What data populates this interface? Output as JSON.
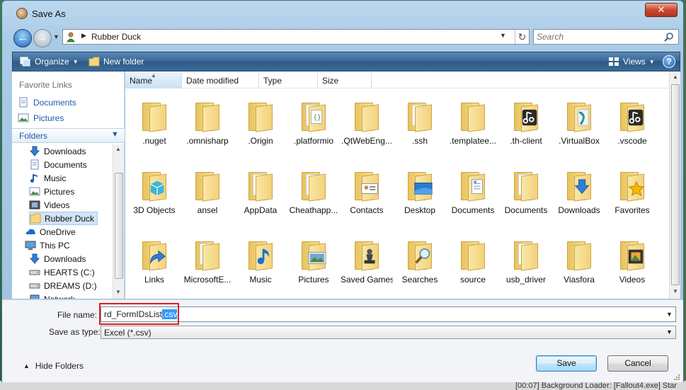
{
  "window": {
    "title": "Save As",
    "close_label": "✕"
  },
  "address": {
    "path": "Rubber Duck",
    "separator": "▶"
  },
  "search": {
    "placeholder": "Search"
  },
  "toolbar": {
    "organize": "Organize",
    "new_folder": "New folder",
    "views": "Views",
    "help": "?"
  },
  "left_pane": {
    "favorites_header": "Favorite Links",
    "favorites": [
      {
        "label": "Documents",
        "icon": "documents-icon"
      },
      {
        "label": "Pictures",
        "icon": "pictures-icon"
      }
    ],
    "folders_header": "Folders",
    "tree": [
      {
        "label": "Downloads",
        "icon": "download-arrow-icon",
        "indent": 1
      },
      {
        "label": "Documents",
        "icon": "documents-icon",
        "indent": 1
      },
      {
        "label": "Music",
        "icon": "music-note-icon",
        "indent": 1
      },
      {
        "label": "Pictures",
        "icon": "pictures-icon",
        "indent": 1
      },
      {
        "label": "Videos",
        "icon": "videos-icon",
        "indent": 1
      },
      {
        "label": "Rubber Duck",
        "icon": "folder-icon",
        "indent": 1,
        "selected": true
      },
      {
        "label": "OneDrive",
        "icon": "onedrive-cloud-icon",
        "indent": 0
      },
      {
        "label": "This PC",
        "icon": "computer-icon",
        "indent": 0
      },
      {
        "label": "Downloads",
        "icon": "download-arrow-icon",
        "indent": 1
      },
      {
        "label": "HEARTS (C:)",
        "icon": "drive-icon",
        "indent": 1
      },
      {
        "label": "DREAMS (D:)",
        "icon": "drive-icon",
        "indent": 1
      },
      {
        "label": "Network",
        "icon": "network-icon",
        "indent": 1
      }
    ]
  },
  "columns": [
    "Name",
    "Date modified",
    "Type",
    "Size"
  ],
  "files": [
    {
      "label": ".nuget",
      "icon": "folder-icon"
    },
    {
      "label": ".omnisharp",
      "icon": "folder-icon"
    },
    {
      "label": ".Origin",
      "icon": "folder-icon"
    },
    {
      "label": ".platformio",
      "icon": "folder-code-icon"
    },
    {
      "label": ".QtWebEng...",
      "icon": "folder-icon"
    },
    {
      "label": ".ssh",
      "icon": "folder-pages-icon"
    },
    {
      "label": ".templatee...",
      "icon": "folder-icon"
    },
    {
      "label": ".th-client",
      "icon": "folder-music-app-icon"
    },
    {
      "label": ".VirtualBox",
      "icon": "folder-virtualbox-icon"
    },
    {
      "label": ".vscode",
      "icon": "folder-music-app-icon"
    },
    {
      "label": "3D Objects",
      "icon": "folder-3d-cube-icon"
    },
    {
      "label": "ansel",
      "icon": "folder-icon"
    },
    {
      "label": "AppData",
      "icon": "folder-pages-icon"
    },
    {
      "label": "Cheathapp...",
      "icon": "folder-pages-icon"
    },
    {
      "label": "Contacts",
      "icon": "folder-contacts-icon"
    },
    {
      "label": "Desktop",
      "icon": "folder-desktop-icon"
    },
    {
      "label": "Documents",
      "icon": "folder-documents-icon"
    },
    {
      "label": "Documents",
      "icon": "folder-pages-icon"
    },
    {
      "label": "Downloads",
      "icon": "folder-download-icon"
    },
    {
      "label": "Favorites",
      "icon": "folder-star-icon"
    },
    {
      "label": "Links",
      "icon": "folder-link-arrow-icon"
    },
    {
      "label": "MicrosoftE...",
      "icon": "folder-pages-icon"
    },
    {
      "label": "Music",
      "icon": "folder-music-note-icon"
    },
    {
      "label": "Pictures",
      "icon": "folder-pictures-icon"
    },
    {
      "label": "Saved Games",
      "icon": "folder-chess-icon"
    },
    {
      "label": "Searches",
      "icon": "folder-magnifier-icon"
    },
    {
      "label": "source",
      "icon": "folder-icon"
    },
    {
      "label": "usb_driver",
      "icon": "folder-pages-icon"
    },
    {
      "label": "Viasfora",
      "icon": "folder-icon"
    },
    {
      "label": "Videos",
      "icon": "folder-filmstrip-icon"
    }
  ],
  "bottom": {
    "file_name_label": "File name:",
    "file_name_base": "rd_FormIDsList",
    "file_name_ext": ".csv",
    "save_type_label": "Save as type:",
    "save_type_value": "Excel (*.csv)",
    "hide_folders": "Hide Folders",
    "save": "Save",
    "cancel": "Cancel"
  },
  "background_text": "[00:07] Background Loader: [Fallout4.exe] Star"
}
